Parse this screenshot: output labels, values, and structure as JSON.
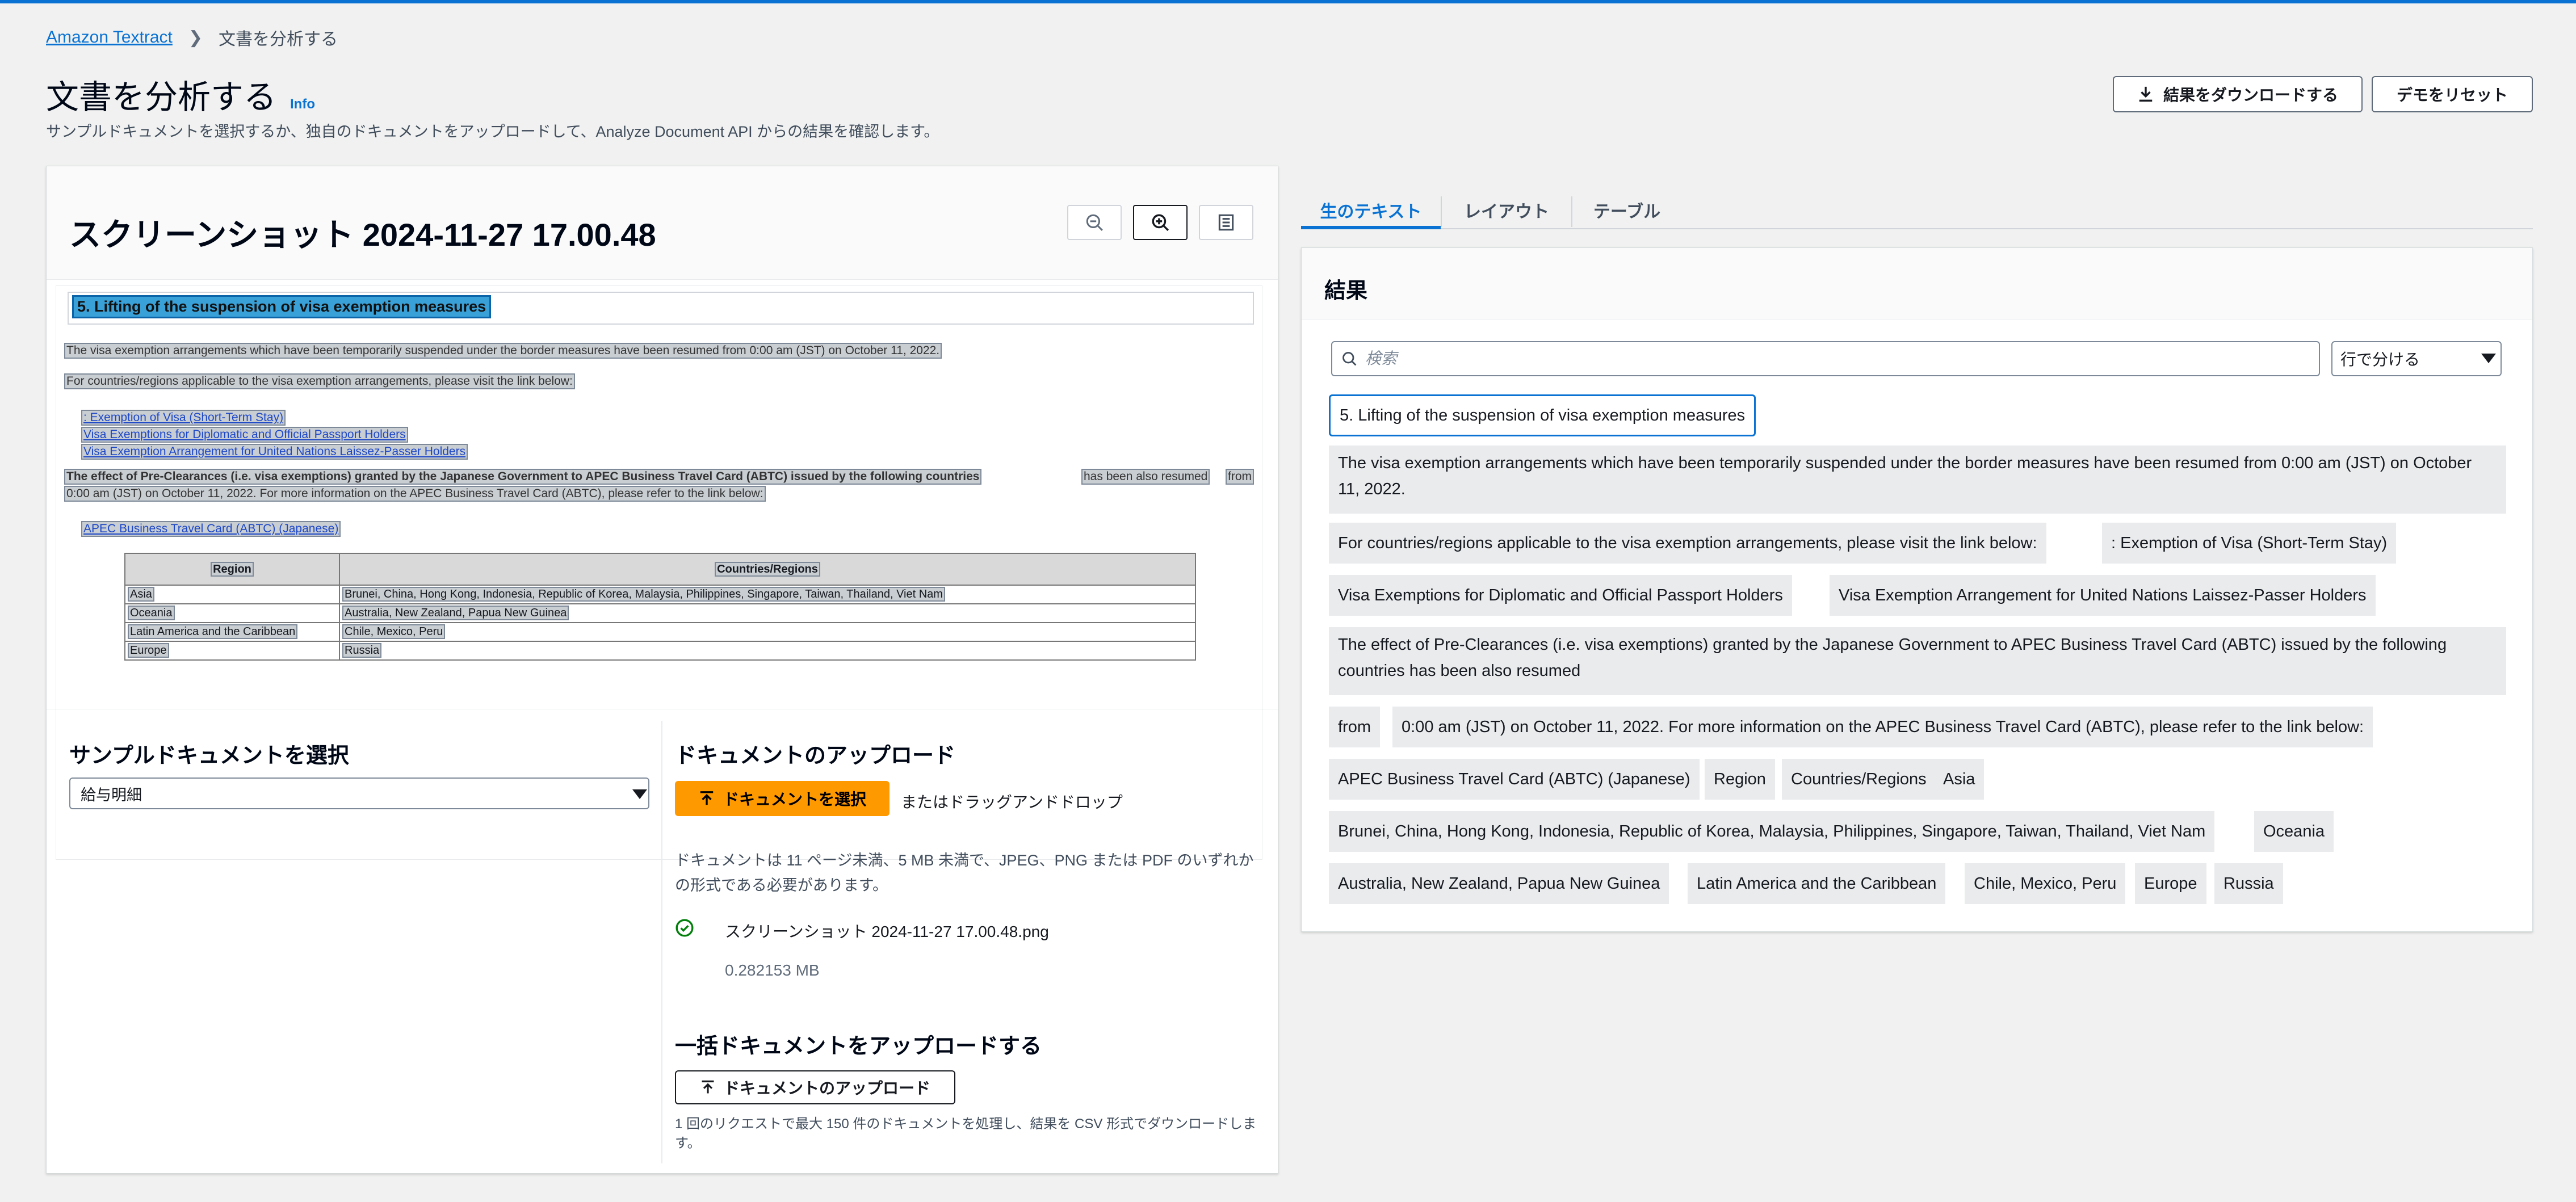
{
  "breadcrumb": {
    "root": "Amazon Textract",
    "current": "文書を分析する"
  },
  "page": {
    "title": "文書を分析する",
    "info": "Info",
    "description": "サンプルドキュメントを選択するか、独自のドキュメントをアップロードして、Analyze Document API からの結果を確認します。",
    "download_button": "結果をダウンロードする",
    "reset_button": "デモをリセット"
  },
  "document": {
    "title": "スクリーンショット 2024-11-27 17.00.48",
    "zoom_icons": [
      "zoom-out-icon",
      "zoom-in-icon",
      "fit-page-icon"
    ],
    "preview": {
      "heading": "5. Lifting of the suspension of visa exemption measures",
      "line1": "The visa exemption arrangements which have been temporarily suspended under the border measures have been resumed from 0:00 am (JST) on October 11, 2022.",
      "line2": "For countries/regions applicable to the visa exemption arrangements, please visit the link below:",
      "link1": ": Exemption of Visa (Short-Term Stay)",
      "link2": "Visa Exemptions for Diplomatic and Official Passport Holders",
      "link3": "Visa Exemption Arrangement for United Nations Laissez-Passer Holders",
      "para_bold": "The effect of Pre-Clearances (i.e. visa exemptions) granted by the Japanese Government to APEC Business Travel Card (ABTC) issued by the following countries",
      "para_tail": "has been also resumed",
      "para_from": "from",
      "para_line2": "0:00 am (JST) on October 11, 2022. For more information on the APEC Business Travel Card (ABTC), please refer to the link below:",
      "link4": "APEC Business Travel Card (ABTC) (Japanese)",
      "table": {
        "headers": [
          "Region",
          "Countries/Regions"
        ],
        "rows": [
          [
            "Asia",
            "Brunei, China, Hong Kong, Indonesia, Republic of Korea, Malaysia, Philippines, Singapore, Taiwan, Thailand, Viet Nam"
          ],
          [
            "Oceania",
            "Australia, New Zealand, Papua New Guinea"
          ],
          [
            "Latin America and the Caribbean",
            "Chile, Mexico, Peru"
          ],
          [
            "Europe",
            "Russia"
          ]
        ]
      }
    }
  },
  "sample": {
    "heading": "サンプルドキュメントを選択",
    "selected": "給与明細"
  },
  "upload": {
    "heading": "ドキュメントのアップロード",
    "button": "ドキュメントを選択",
    "drag_text": "またはドラッグアンドドロップ",
    "note": "ドキュメントは 11 ページ未満、5 MB 未満で、JPEG、PNG または PDF のいずれかの形式である必要があります。",
    "file_name": "スクリーンショット 2024-11-27 17.00.48.png",
    "file_size": "0.282153 MB",
    "bulk_heading": "一括ドキュメントをアップロードする",
    "bulk_button": "ドキュメントのアップロード",
    "bulk_note": "1 回のリクエストで最大 150 件のドキュメントを処理し、結果を CSV 形式でダウンロードします。"
  },
  "tabs": [
    "生のテキスト",
    "レイアウト",
    "テーブル"
  ],
  "results": {
    "title": "結果",
    "search_placeholder": "検索",
    "split_option": "行で分ける",
    "chips": [
      "5. Lifting of the suspension of visa exemption measures",
      "The visa exemption arrangements which have been temporarily suspended under the border measures have been resumed from 0:00 am (JST) on October 11, 2022.",
      "For countries/regions applicable to the visa exemption arrangements, please visit the link below:",
      ": Exemption of Visa (Short-Term Stay)",
      "Visa Exemptions for Diplomatic and Official Passport Holders",
      "Visa Exemption Arrangement for United Nations Laissez-Passer Holders",
      "The effect of Pre-Clearances (i.e. visa exemptions) granted by the Japanese Government to APEC Business Travel Card (ABTC) issued by the following countries has been also resumed",
      "from",
      "0:00 am (JST) on October 11, 2022. For more information on the APEC Business Travel Card (ABTC), please refer to the link below:",
      "APEC Business Travel Card (ABTC) (Japanese)",
      "Region",
      "Countries/Regions",
      "Asia",
      "Brunei, China, Hong Kong, Indonesia, Republic of Korea, Malaysia, Philippines, Singapore, Taiwan, Thailand, Viet Nam",
      "Oceania",
      "Australia, New Zealand, Papua New Guinea",
      "Latin America and the Caribbean",
      "Chile, Mexico, Peru",
      "Europe",
      "Russia"
    ]
  },
  "colors": {
    "accent": "#0972d3",
    "primary_button": "#ff9900",
    "success": "#037f0c",
    "chip_bg": "#e9ebed"
  }
}
